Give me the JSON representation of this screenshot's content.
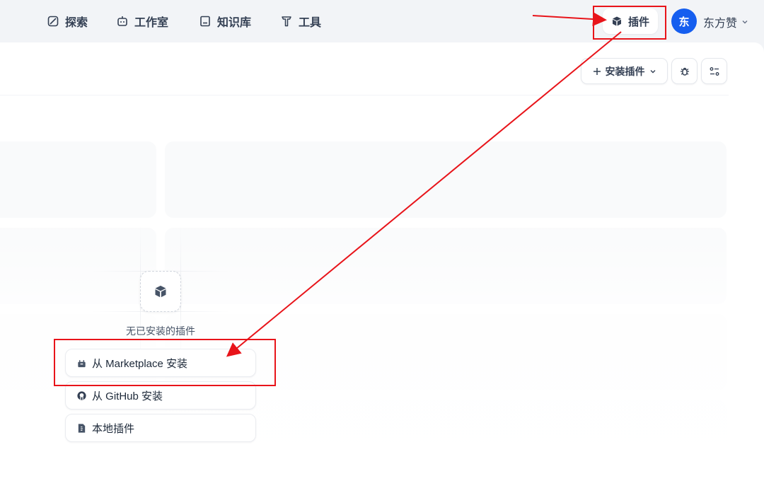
{
  "nav": {
    "items": [
      {
        "label": "探索",
        "icon": "explore-icon"
      },
      {
        "label": "工作室",
        "icon": "robot-icon"
      },
      {
        "label": "知识库",
        "icon": "book-icon"
      },
      {
        "label": "工具",
        "icon": "tool-icon"
      }
    ],
    "plugin_label": "插件",
    "user": {
      "initial": "东",
      "name": "东方赞"
    }
  },
  "toolbar": {
    "install_label": "安装插件",
    "debug_icon": "bug-icon",
    "settings_icon": "sliders-icon"
  },
  "empty_state": {
    "message": "无已安装的插件",
    "options": [
      {
        "label": "从 Marketplace 安装",
        "icon": "marketplace-icon"
      },
      {
        "label": "从 GitHub 安装",
        "icon": "github-icon"
      },
      {
        "label": "本地插件",
        "icon": "file-icon"
      }
    ]
  },
  "annotation_color": "#e8141a"
}
